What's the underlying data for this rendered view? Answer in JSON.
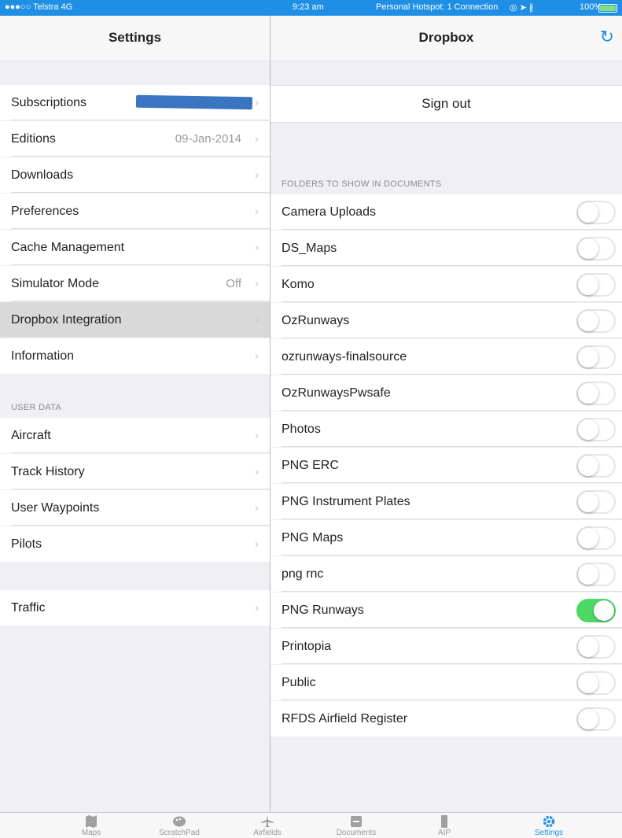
{
  "status": {
    "carrier": "●●●○○ Telstra  4G",
    "time": "9:23 am",
    "hotspot": "Personal Hotspot: 1 Connection",
    "battery": "100%"
  },
  "left": {
    "title": "Settings",
    "items": [
      {
        "label": "Subscriptions",
        "detail": ""
      },
      {
        "label": "Editions",
        "detail": "09-Jan-2014"
      },
      {
        "label": "Downloads",
        "detail": ""
      },
      {
        "label": "Preferences",
        "detail": ""
      },
      {
        "label": "Cache Management",
        "detail": ""
      },
      {
        "label": "Simulator Mode",
        "detail": "Off"
      },
      {
        "label": "Dropbox Integration",
        "detail": ""
      },
      {
        "label": "Information",
        "detail": ""
      }
    ],
    "user_data_header": "USER DATA",
    "user_items": [
      {
        "label": "Aircraft"
      },
      {
        "label": "Track History"
      },
      {
        "label": "User Waypoints"
      },
      {
        "label": "Pilots"
      }
    ],
    "traffic": "Traffic"
  },
  "right": {
    "title": "Dropbox",
    "sign_out": "Sign out",
    "folders_header": "FOLDERS TO SHOW IN DOCUMENTS",
    "folders": [
      {
        "label": "Camera Uploads",
        "on": false
      },
      {
        "label": "DS_Maps",
        "on": false
      },
      {
        "label": "Komo",
        "on": false
      },
      {
        "label": "OzRunways",
        "on": false
      },
      {
        "label": "ozrunways-finalsource",
        "on": false
      },
      {
        "label": "OzRunwaysPwsafe",
        "on": false
      },
      {
        "label": "Photos",
        "on": false
      },
      {
        "label": "PNG ERC",
        "on": false
      },
      {
        "label": "PNG Instrument Plates",
        "on": false
      },
      {
        "label": "PNG Maps",
        "on": false
      },
      {
        "label": "png rnc",
        "on": false
      },
      {
        "label": "PNG Runways",
        "on": true
      },
      {
        "label": "Printopia",
        "on": false
      },
      {
        "label": "Public",
        "on": false
      },
      {
        "label": "RFDS Airfield Register",
        "on": false
      }
    ]
  },
  "tabs": [
    {
      "label": "Maps",
      "icon": "map-icon"
    },
    {
      "label": "ScratchPad",
      "icon": "palette-icon"
    },
    {
      "label": "Airfields",
      "icon": "airplane-icon"
    },
    {
      "label": "Documents",
      "icon": "documents-icon"
    },
    {
      "label": "AIP",
      "icon": "book-icon"
    },
    {
      "label": "Settings",
      "icon": "gear-icon"
    }
  ]
}
